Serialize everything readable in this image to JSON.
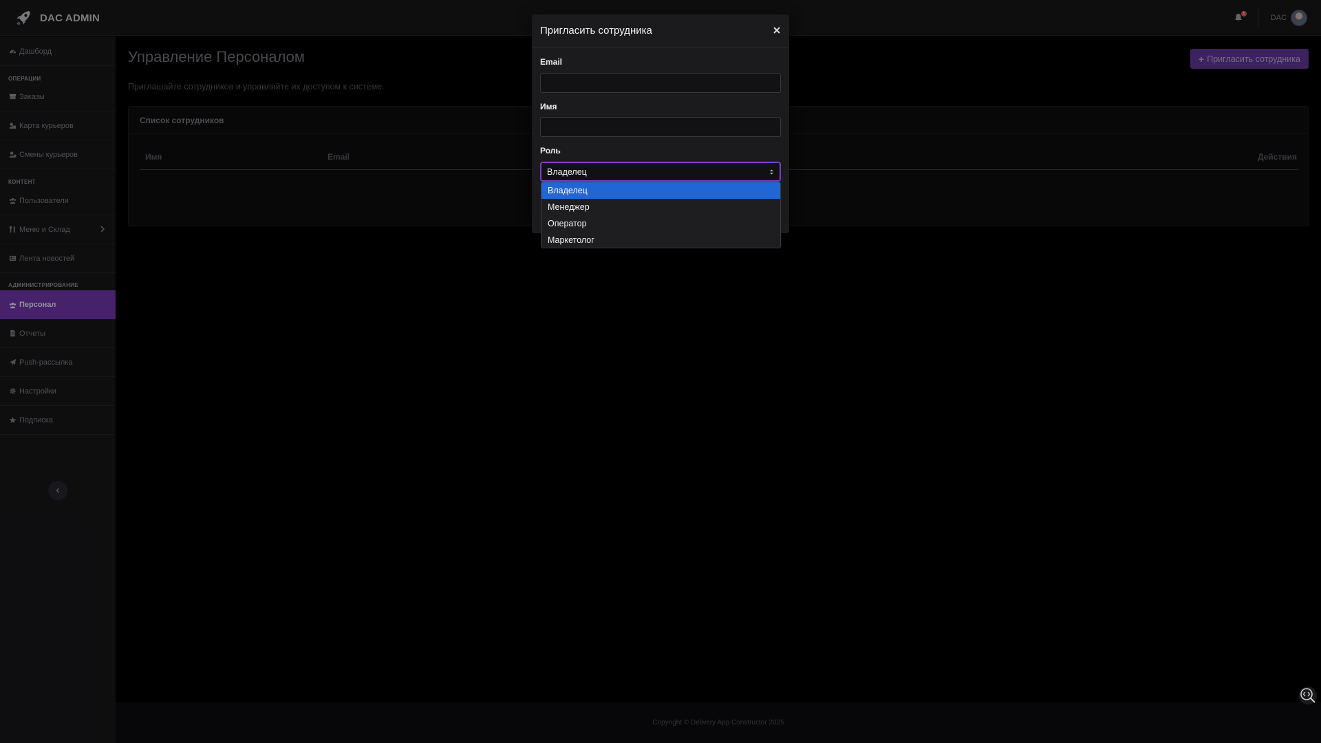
{
  "brand": {
    "name": "DAC ADMIN"
  },
  "topbar": {
    "notification_count": "1",
    "user_name": "DAC"
  },
  "sidebar": {
    "items": [
      {
        "label": "Дашборд",
        "icon": "gauge-icon"
      },
      {
        "label": "Заказы",
        "icon": "box-icon"
      },
      {
        "label": "Карта курьеров",
        "icon": "map-icon"
      },
      {
        "label": "Смены курьеров",
        "icon": "user-clock-icon"
      },
      {
        "label": "Пользователи",
        "icon": "users-icon"
      },
      {
        "label": "Меню и Склад",
        "icon": "utensils-icon"
      },
      {
        "label": "Лента новостей",
        "icon": "newspaper-icon"
      },
      {
        "label": "Персонал",
        "icon": "staff-icon"
      },
      {
        "label": "Отчеты",
        "icon": "file-icon"
      },
      {
        "label": "Push-рассылка",
        "icon": "paper-plane-icon"
      },
      {
        "label": "Настройки",
        "icon": "gear-icon"
      },
      {
        "label": "Подписка",
        "icon": "star-icon"
      }
    ],
    "sections": [
      "ОПЕРАЦИИ",
      "КОНТЕНТ",
      "АДМИНИСТРИРОВАНИЕ"
    ],
    "active_index": 7
  },
  "main": {
    "title": "Управление Персоналом",
    "subtitle": "Приглашайте сотрудников и управляйте их доступом к системе.",
    "invite_button": "Пригласить сотрудника",
    "card_title": "Список сотрудников",
    "columns": [
      "Имя",
      "Email",
      "Действия"
    ]
  },
  "modal": {
    "title": "Пригласить сотрудника",
    "email_label": "Email",
    "email_value": "",
    "name_label": "Имя",
    "name_value": "",
    "role_label": "Роль",
    "role_value": "Владелец",
    "role_options": [
      "Владелец",
      "Менеджер",
      "Оператор",
      "Маркетолог"
    ]
  },
  "footer": {
    "copyright": "Copyright © Delivery App Constructor 2025"
  },
  "colors": {
    "accent": "#6a35a4",
    "accent_button": "#5c3591",
    "select_highlight": "#2066d6",
    "focus_border": "#7a3fc4",
    "badge": "#d9534f"
  }
}
